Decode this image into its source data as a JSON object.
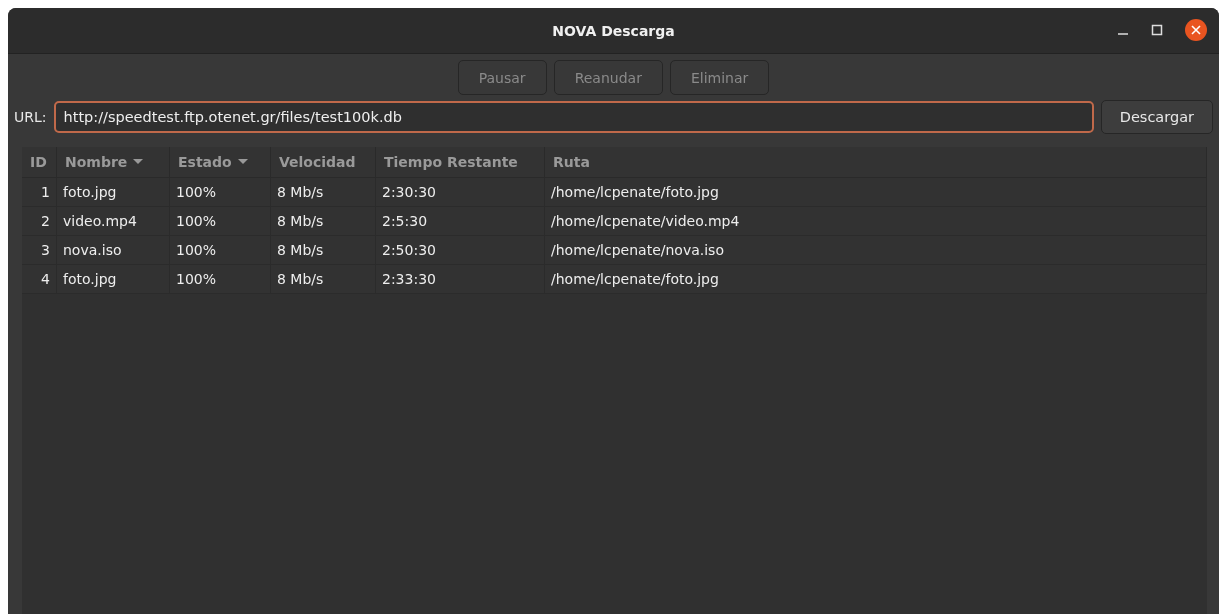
{
  "window": {
    "title": "NOVA Descarga"
  },
  "toolbar": [
    {
      "label": "Pausar",
      "disabled": true
    },
    {
      "label": "Reanudar",
      "disabled": true
    },
    {
      "label": "Eliminar",
      "disabled": true
    }
  ],
  "url": {
    "label": "URL:",
    "value": "http://speedtest.ftp.otenet.gr/files/test100k.db",
    "focused": true
  },
  "download_button": {
    "label": "Descargar",
    "disabled": false
  },
  "table": {
    "columns": [
      {
        "label": "ID"
      },
      {
        "label": "Nombre",
        "sort_menu": true
      },
      {
        "label": "Estado",
        "sort_menu": true
      },
      {
        "label": "Velocidad"
      },
      {
        "label": "Tiempo Restante"
      },
      {
        "label": "Ruta"
      }
    ],
    "rows": [
      [
        "1",
        "foto.jpg",
        "100%",
        "8 Mb/s",
        "2:30:30",
        "/home/lcpenate/foto.jpg"
      ],
      [
        "2",
        "video.mp4",
        "100%",
        "8 Mb/s",
        "2:5:30",
        "/home/lcpenate/video.mp4"
      ],
      [
        "3",
        "nova.iso",
        "100%",
        "8 Mb/s",
        "2:50:30",
        "/home/lcpenate/nova.iso"
      ],
      [
        "4",
        "foto.jpg",
        "100%",
        "8 Mb/s",
        "2:33:30",
        "/home/lcpenate/foto.jpg"
      ]
    ]
  }
}
